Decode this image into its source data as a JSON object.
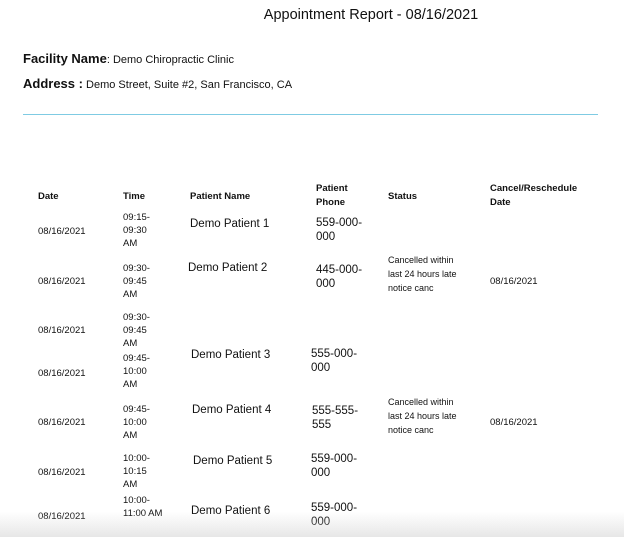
{
  "report": {
    "title": "Appointment Report - 08/16/2021",
    "facility_label": "Facility Name",
    "facility_value": ": Demo Chiropractic Clinic",
    "address_label": "Address :",
    "address_value": " Demo Street, Suite #2, San Francisco, CA"
  },
  "table": {
    "headers": {
      "date": "Date",
      "time": "Time",
      "patient_name": "Patient Name",
      "patient_phone": "Patient Phone",
      "status": "Status",
      "cancel_date": "Cancel/Reschedule Date"
    },
    "rows": [
      {
        "date": "08/16/2021",
        "time": "09:15-09:30 AM",
        "name": "Demo Patient 1",
        "phone": "559-000-000",
        "status": "",
        "cancel_date": ""
      },
      {
        "date": "08/16/2021",
        "time": "09:30-09:45 AM",
        "name": "Demo Patient 2",
        "phone": "445-000-000",
        "status": "Cancelled within last 24 hours late notice canc",
        "cancel_date": "08/16/2021"
      },
      {
        "date": "08/16/2021",
        "time": "09:30-09:45 AM",
        "name": "",
        "phone": "",
        "status": "",
        "cancel_date": ""
      },
      {
        "date": "08/16/2021",
        "time": "09:45-10:00 AM",
        "name": "Demo Patient 3",
        "phone": "555-000-000",
        "status": "",
        "cancel_date": ""
      },
      {
        "date": "08/16/2021",
        "time": "09:45-10:00 AM",
        "name": "Demo Patient 4",
        "phone": "555-555-555",
        "status": "Cancelled within last 24 hours late notice canc",
        "cancel_date": "08/16/2021"
      },
      {
        "date": "08/16/2021",
        "time": "10:00-10:15 AM",
        "name": "Demo Patient 5",
        "phone": "559-000-000",
        "status": "",
        "cancel_date": ""
      },
      {
        "date": "08/16/2021",
        "time": "10:00-11:00 AM",
        "name": "Demo Patient 6",
        "phone": "559-000-000",
        "status": "",
        "cancel_date": ""
      }
    ]
  }
}
